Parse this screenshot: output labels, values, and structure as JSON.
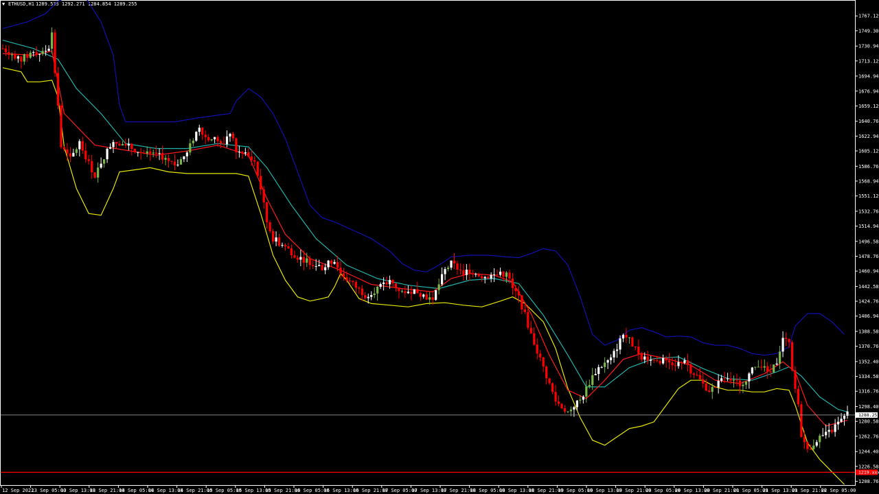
{
  "header": {
    "dropdown_glyph": "▼",
    "symbol": "ETHUSD,H1",
    "ohlc": "1289.535 1292.271 1284.854 1289.255"
  },
  "colors": {
    "background": "#000000",
    "axis": "#ffffff",
    "bull_candle": "#ffffff",
    "bear_candle": "#ff0000",
    "bull_alt": "#7ab648",
    "bb_upper": "#1010b0",
    "bb_lower": "#e6e600",
    "ma_fast": "#ff1a1a",
    "ma_slow": "#20b2aa",
    "bid_line": "#b0b0b0",
    "support_line": "#ff0000"
  },
  "chart_data": {
    "type": "candlestick",
    "symbol": "ETHUSD",
    "timeframe": "H1",
    "y_ticks": [
      "1767.120",
      "1749.300",
      "1730.940",
      "1713.120",
      "1694.940",
      "1676.940",
      "1659.120",
      "1640.760",
      "1622.940",
      "1605.120",
      "1586.760",
      "1568.940",
      "1551.120",
      "1532.760",
      "1514.940",
      "1496.580",
      "1478.760",
      "1460.940",
      "1442.580",
      "1424.760",
      "1406.940",
      "1388.580",
      "1370.760",
      "1352.400",
      "1334.580",
      "1316.760",
      "1298.400",
      "1280.580",
      "1262.760",
      "1244.400",
      "1226.580",
      "1208.760"
    ],
    "x_ticks": [
      "12 Sep 2022",
      "13 Sep 05:00",
      "13 Sep 13:00",
      "13 Sep 21:00",
      "14 Sep 05:00",
      "14 Sep 13:00",
      "14 Sep 21:00",
      "15 Sep 05:00",
      "15 Sep 13:00",
      "15 Sep 21:00",
      "16 Sep 05:00",
      "16 Sep 13:00",
      "16 Sep 21:00",
      "17 Sep 05:00",
      "17 Sep 13:00",
      "17 Sep 21:00",
      "18 Sep 05:00",
      "18 Sep 13:00",
      "18 Sep 21:00",
      "19 Sep 05:00",
      "19 Sep 13:00",
      "19 Sep 21:00",
      "20 Sep 05:00",
      "20 Sep 13:00",
      "20 Sep 21:00",
      "21 Sep 05:00",
      "21 Sep 13:00",
      "21 Sep 21:00",
      "22 Sep 05:00"
    ],
    "current_price_label": "1288.255",
    "current_price": 1288.255,
    "support_label": "1219.xxx",
    "support_price": 1219.5,
    "ylim": [
      1205,
      1778
    ],
    "price_path": [
      [
        0,
        1728
      ],
      [
        6,
        1715
      ],
      [
        10,
        1724
      ],
      [
        13,
        1722
      ],
      [
        15,
        1730
      ],
      [
        16,
        1748
      ],
      [
        17,
        1700
      ],
      [
        18,
        1660
      ],
      [
        19,
        1610
      ],
      [
        22,
        1595
      ],
      [
        25,
        1615
      ],
      [
        28,
        1590
      ],
      [
        30,
        1575
      ],
      [
        32,
        1592
      ],
      [
        36,
        1618
      ],
      [
        40,
        1612
      ],
      [
        46,
        1602
      ],
      [
        52,
        1598
      ],
      [
        56,
        1588
      ],
      [
        60,
        1602
      ],
      [
        62,
        1620
      ],
      [
        64,
        1635
      ],
      [
        66,
        1622
      ],
      [
        70,
        1618
      ],
      [
        72,
        1610
      ],
      [
        74,
        1628
      ],
      [
        76,
        1605
      ],
      [
        80,
        1598
      ],
      [
        82,
        1592
      ],
      [
        84,
        1560
      ],
      [
        86,
        1520
      ],
      [
        88,
        1500
      ],
      [
        92,
        1490
      ],
      [
        96,
        1478
      ],
      [
        100,
        1472
      ],
      [
        104,
        1465
      ],
      [
        108,
        1475
      ],
      [
        110,
        1458
      ],
      [
        114,
        1445
      ],
      [
        118,
        1432
      ],
      [
        122,
        1440
      ],
      [
        126,
        1448
      ],
      [
        130,
        1436
      ],
      [
        134,
        1438
      ],
      [
        138,
        1430
      ],
      [
        140,
        1428
      ],
      [
        142,
        1445
      ],
      [
        144,
        1462
      ],
      [
        146,
        1470
      ],
      [
        148,
        1465
      ],
      [
        150,
        1458
      ],
      [
        152,
        1462
      ],
      [
        156,
        1455
      ],
      [
        160,
        1456
      ],
      [
        164,
        1458
      ],
      [
        166,
        1440
      ],
      [
        168,
        1430
      ],
      [
        170,
        1408
      ],
      [
        172,
        1385
      ],
      [
        174,
        1365
      ],
      [
        176,
        1345
      ],
      [
        178,
        1325
      ],
      [
        180,
        1305
      ],
      [
        182,
        1298
      ],
      [
        184,
        1292
      ],
      [
        186,
        1300
      ],
      [
        188,
        1306
      ],
      [
        190,
        1320
      ],
      [
        192,
        1335
      ],
      [
        194,
        1345
      ],
      [
        196,
        1350
      ],
      [
        198,
        1355
      ],
      [
        200,
        1370
      ],
      [
        202,
        1385
      ],
      [
        204,
        1378
      ],
      [
        206,
        1368
      ],
      [
        208,
        1358
      ],
      [
        212,
        1356
      ],
      [
        216,
        1352
      ],
      [
        220,
        1350
      ],
      [
        222,
        1356
      ],
      [
        224,
        1342
      ],
      [
        226,
        1335
      ],
      [
        228,
        1325
      ],
      [
        230,
        1318
      ],
      [
        232,
        1322
      ],
      [
        234,
        1330
      ],
      [
        236,
        1335
      ],
      [
        238,
        1328
      ],
      [
        240,
        1325
      ],
      [
        242,
        1332
      ],
      [
        244,
        1342
      ],
      [
        246,
        1350
      ],
      [
        248,
        1345
      ],
      [
        250,
        1340
      ],
      [
        252,
        1352
      ],
      [
        254,
        1382
      ],
      [
        256,
        1372
      ],
      [
        257,
        1340
      ],
      [
        259,
        1298
      ],
      [
        260,
        1265
      ],
      [
        262,
        1245
      ],
      [
        264,
        1255
      ],
      [
        266,
        1262
      ],
      [
        268,
        1265
      ],
      [
        270,
        1270
      ],
      [
        272,
        1278
      ],
      [
        274,
        1285
      ],
      [
        275,
        1289
      ]
    ],
    "ma_fast_path": [
      [
        0,
        1722
      ],
      [
        10,
        1720
      ],
      [
        16,
        1725
      ],
      [
        20,
        1650
      ],
      [
        30,
        1612
      ],
      [
        40,
        1606
      ],
      [
        50,
        1600
      ],
      [
        60,
        1605
      ],
      [
        70,
        1612
      ],
      [
        80,
        1600
      ],
      [
        86,
        1548
      ],
      [
        92,
        1505
      ],
      [
        100,
        1476
      ],
      [
        110,
        1462
      ],
      [
        120,
        1445
      ],
      [
        130,
        1440
      ],
      [
        140,
        1436
      ],
      [
        146,
        1452
      ],
      [
        152,
        1458
      ],
      [
        160,
        1456
      ],
      [
        166,
        1448
      ],
      [
        172,
        1410
      ],
      [
        178,
        1360
      ],
      [
        184,
        1318
      ],
      [
        190,
        1308
      ],
      [
        196,
        1330
      ],
      [
        202,
        1355
      ],
      [
        208,
        1362
      ],
      [
        216,
        1356
      ],
      [
        224,
        1348
      ],
      [
        232,
        1330
      ],
      [
        240,
        1326
      ],
      [
        248,
        1338
      ],
      [
        254,
        1352
      ],
      [
        258,
        1340
      ],
      [
        262,
        1300
      ],
      [
        268,
        1275
      ],
      [
        275,
        1282
      ]
    ],
    "ma_slow_path": [
      [
        0,
        1738
      ],
      [
        10,
        1728
      ],
      [
        18,
        1715
      ],
      [
        24,
        1680
      ],
      [
        32,
        1650
      ],
      [
        40,
        1614
      ],
      [
        50,
        1608
      ],
      [
        60,
        1608
      ],
      [
        70,
        1614
      ],
      [
        80,
        1610
      ],
      [
        86,
        1585
      ],
      [
        94,
        1540
      ],
      [
        102,
        1500
      ],
      [
        112,
        1468
      ],
      [
        122,
        1452
      ],
      [
        132,
        1444
      ],
      [
        142,
        1440
      ],
      [
        152,
        1450
      ],
      [
        160,
        1452
      ],
      [
        168,
        1446
      ],
      [
        176,
        1408
      ],
      [
        184,
        1360
      ],
      [
        190,
        1322
      ],
      [
        196,
        1322
      ],
      [
        204,
        1345
      ],
      [
        212,
        1356
      ],
      [
        220,
        1358
      ],
      [
        228,
        1344
      ],
      [
        236,
        1332
      ],
      [
        244,
        1330
      ],
      [
        252,
        1340
      ],
      [
        256,
        1346
      ],
      [
        260,
        1335
      ],
      [
        266,
        1310
      ],
      [
        272,
        1295
      ],
      [
        275,
        1292
      ]
    ],
    "bb_upper_path": [
      [
        0,
        1752
      ],
      [
        8,
        1760
      ],
      [
        14,
        1770
      ],
      [
        18,
        1785
      ],
      [
        26,
        1795
      ],
      [
        32,
        1760
      ],
      [
        36,
        1720
      ],
      [
        38,
        1660
      ],
      [
        40,
        1640
      ],
      [
        48,
        1640
      ],
      [
        56,
        1640
      ],
      [
        64,
        1645
      ],
      [
        70,
        1648
      ],
      [
        74,
        1650
      ],
      [
        76,
        1665
      ],
      [
        80,
        1680
      ],
      [
        84,
        1670
      ],
      [
        88,
        1650
      ],
      [
        92,
        1620
      ],
      [
        96,
        1580
      ],
      [
        100,
        1540
      ],
      [
        104,
        1525
      ],
      [
        108,
        1520
      ],
      [
        114,
        1510
      ],
      [
        120,
        1500
      ],
      [
        126,
        1485
      ],
      [
        130,
        1470
      ],
      [
        134,
        1462
      ],
      [
        138,
        1460
      ],
      [
        142,
        1468
      ],
      [
        146,
        1478
      ],
      [
        152,
        1480
      ],
      [
        158,
        1480
      ],
      [
        164,
        1478
      ],
      [
        168,
        1477
      ],
      [
        172,
        1482
      ],
      [
        176,
        1488
      ],
      [
        180,
        1485
      ],
      [
        184,
        1468
      ],
      [
        188,
        1430
      ],
      [
        192,
        1385
      ],
      [
        196,
        1372
      ],
      [
        200,
        1378
      ],
      [
        204,
        1390
      ],
      [
        208,
        1393
      ],
      [
        212,
        1388
      ],
      [
        216,
        1382
      ],
      [
        220,
        1383
      ],
      [
        224,
        1382
      ],
      [
        228,
        1375
      ],
      [
        232,
        1372
      ],
      [
        236,
        1372
      ],
      [
        240,
        1368
      ],
      [
        244,
        1362
      ],
      [
        248,
        1360
      ],
      [
        252,
        1362
      ],
      [
        256,
        1370
      ],
      [
        258,
        1395
      ],
      [
        262,
        1410
      ],
      [
        266,
        1410
      ],
      [
        270,
        1400
      ],
      [
        274,
        1385
      ]
    ],
    "bb_lower_path": [
      [
        0,
        1705
      ],
      [
        6,
        1700
      ],
      [
        8,
        1688
      ],
      [
        12,
        1688
      ],
      [
        16,
        1690
      ],
      [
        18,
        1670
      ],
      [
        20,
        1610
      ],
      [
        24,
        1560
      ],
      [
        28,
        1530
      ],
      [
        32,
        1528
      ],
      [
        36,
        1560
      ],
      [
        38,
        1580
      ],
      [
        42,
        1582
      ],
      [
        48,
        1585
      ],
      [
        54,
        1580
      ],
      [
        60,
        1578
      ],
      [
        70,
        1578
      ],
      [
        76,
        1578
      ],
      [
        80,
        1575
      ],
      [
        84,
        1530
      ],
      [
        88,
        1480
      ],
      [
        92,
        1450
      ],
      [
        96,
        1430
      ],
      [
        100,
        1425
      ],
      [
        104,
        1428
      ],
      [
        106,
        1430
      ],
      [
        108,
        1442
      ],
      [
        110,
        1458
      ],
      [
        112,
        1450
      ],
      [
        116,
        1428
      ],
      [
        120,
        1422
      ],
      [
        126,
        1420
      ],
      [
        132,
        1418
      ],
      [
        138,
        1422
      ],
      [
        144,
        1423
      ],
      [
        150,
        1420
      ],
      [
        156,
        1418
      ],
      [
        162,
        1425
      ],
      [
        166,
        1430
      ],
      [
        170,
        1422
      ],
      [
        176,
        1400
      ],
      [
        180,
        1368
      ],
      [
        184,
        1320
      ],
      [
        188,
        1285
      ],
      [
        192,
        1258
      ],
      [
        196,
        1252
      ],
      [
        200,
        1262
      ],
      [
        204,
        1272
      ],
      [
        208,
        1275
      ],
      [
        212,
        1280
      ],
      [
        216,
        1300
      ],
      [
        220,
        1320
      ],
      [
        224,
        1330
      ],
      [
        228,
        1330
      ],
      [
        232,
        1322
      ],
      [
        236,
        1318
      ],
      [
        240,
        1318
      ],
      [
        244,
        1316
      ],
      [
        248,
        1316
      ],
      [
        252,
        1320
      ],
      [
        256,
        1318
      ],
      [
        258,
        1300
      ],
      [
        262,
        1255
      ],
      [
        266,
        1235
      ],
      [
        270,
        1220
      ],
      [
        274,
        1205
      ]
    ]
  }
}
